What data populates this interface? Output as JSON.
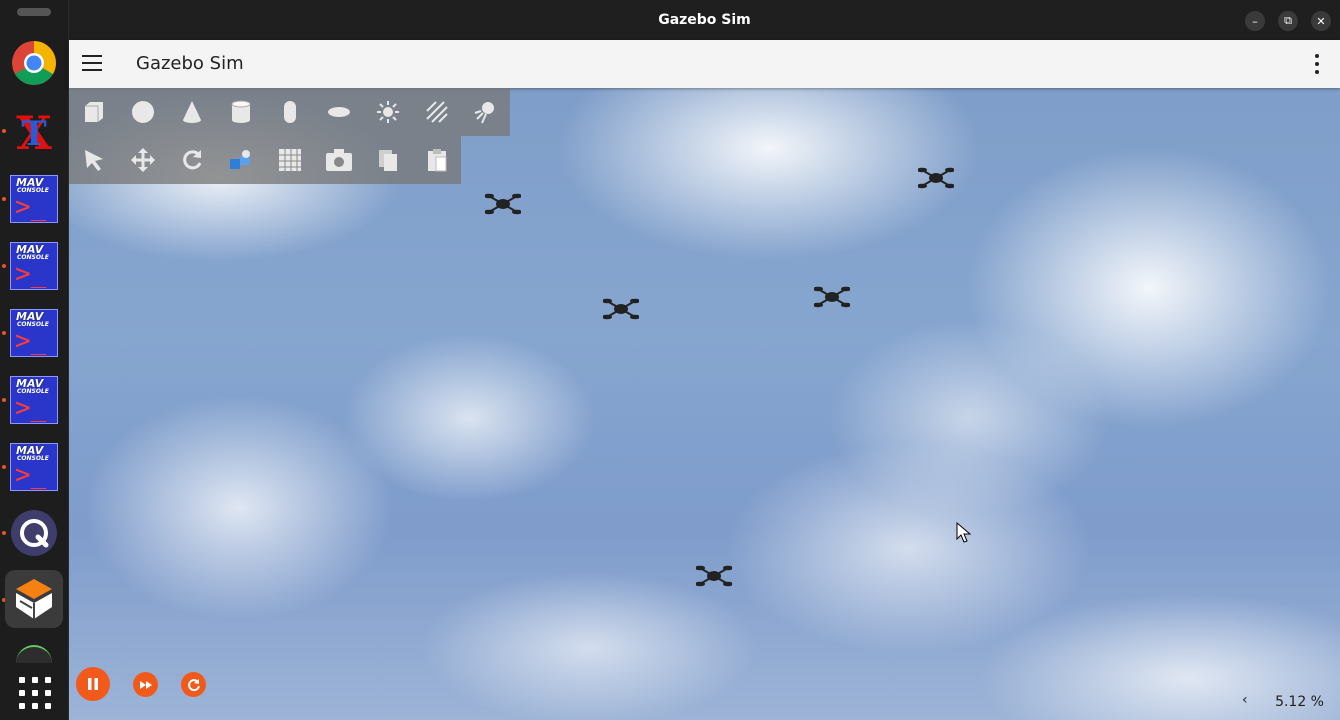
{
  "window": {
    "title": "Gazebo Sim",
    "minimize_label": "–",
    "maximize_label": "⧉",
    "close_label": "✕"
  },
  "appbar": {
    "title": "Gazebo Sim"
  },
  "dock": {
    "items": [
      {
        "name": "chrome",
        "running": false
      },
      {
        "name": "texmaker",
        "running": true
      },
      {
        "name": "mavconsole-1",
        "running": true
      },
      {
        "name": "mavconsole-2",
        "running": true
      },
      {
        "name": "mavconsole-3",
        "running": true
      },
      {
        "name": "mavconsole-4",
        "running": true
      },
      {
        "name": "mavconsole-5",
        "running": true
      },
      {
        "name": "qgroundcontrol",
        "running": true
      },
      {
        "name": "gazebo",
        "running": true,
        "active": true
      }
    ],
    "mav_title": "MAV",
    "mav_subtitle": "CONSOLE",
    "mav_prompt": ">_"
  },
  "toolbar_shapes": [
    "box-icon",
    "sphere-icon",
    "cone-icon",
    "cylinder-icon",
    "capsule-icon",
    "ellipsoid-icon",
    "point-light-icon",
    "directional-light-icon",
    "spot-light-icon"
  ],
  "toolbar_transform": [
    "select-icon",
    "translate-icon",
    "rotate-icon",
    "transform-control-icon",
    "grid-snap-icon",
    "screenshot-icon",
    "copy-icon",
    "paste-icon"
  ],
  "scene": {
    "drones_visible": 5
  },
  "controls": {
    "pause_icon": "pause-icon",
    "step_icon": "fast-forward-icon",
    "reset_icon": "reset-icon"
  },
  "status": {
    "rtf_toggle": "‹",
    "real_time_factor": "5.12 %"
  },
  "colors": {
    "accent": "#f25a1c",
    "sky": "#86a5cf",
    "dock": "#1d1d1d"
  }
}
